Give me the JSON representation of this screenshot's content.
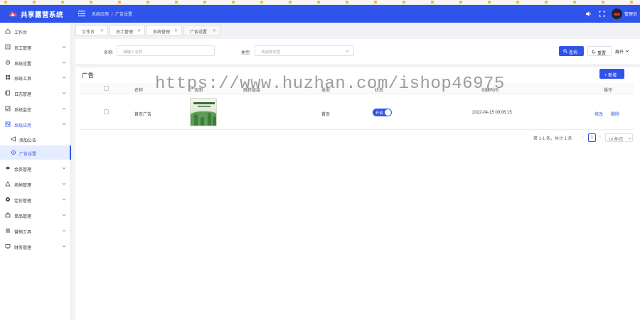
{
  "app": {
    "title": "共享露营系统",
    "username": "管理员"
  },
  "breadcrumb": [
    "系统应用",
    "/",
    "广告设置"
  ],
  "sidebar": {
    "items": [
      {
        "label": "工作台",
        "icon": "home-icon"
      },
      {
        "label": "员工管理",
        "icon": "staff-icon"
      },
      {
        "label": "系统设置",
        "icon": "gear-icon"
      },
      {
        "label": "系统工具",
        "icon": "tools-icon"
      },
      {
        "label": "日志管理",
        "icon": "log-icon"
      },
      {
        "label": "系统监控",
        "icon": "monitor-icon"
      },
      {
        "label": "系统应用",
        "icon": "app-icon"
      },
      {
        "label": "添加公告",
        "icon": "megaphone-icon"
      },
      {
        "label": "广告设置",
        "icon": "ad-settings-icon"
      },
      {
        "label": "会员管理",
        "icon": "member-icon"
      },
      {
        "label": "场地管理",
        "icon": "venue-icon"
      },
      {
        "label": "定价管理",
        "icon": "pricing-icon"
      },
      {
        "label": "单品管理",
        "icon": "product-icon"
      },
      {
        "label": "营销工具",
        "icon": "marketing-icon"
      },
      {
        "label": "财务管理",
        "icon": "finance-icon"
      }
    ]
  },
  "tabs": [
    {
      "label": "工作台"
    },
    {
      "label": "员工管理"
    },
    {
      "label": "系统管理"
    },
    {
      "label": "广告设置"
    }
  ],
  "search": {
    "name_label": "名称:",
    "name_placeholder": "请输入名称",
    "type_label": "类型:",
    "type_placeholder": "请选择类型",
    "query_button": "查询",
    "reset_button": "重置",
    "expand_label": "展开"
  },
  "main": {
    "title": "广告",
    "add_button": "+ 新增",
    "columns": [
      "名称",
      "广告图",
      "跳转链接",
      "类型",
      "状态",
      "创建时间",
      "操作"
    ],
    "rows": [
      {
        "name": "首页广告",
        "link": "",
        "type": "首页",
        "status": "开启",
        "created_at": "2022-04-15 09:06:15",
        "edit": "修改",
        "delete": "删除"
      }
    ]
  },
  "pagination": {
    "total_text": "第 1-1 条，共计 1 条",
    "current_page": "1",
    "page_size": "10 条/页"
  },
  "watermark": "https://www.huzhan.com/ishop46975",
  "colors": {
    "primary": "#2f54eb",
    "sidebar_active_bg": "#e6ecff",
    "page_bg": "#f0f2f5"
  }
}
